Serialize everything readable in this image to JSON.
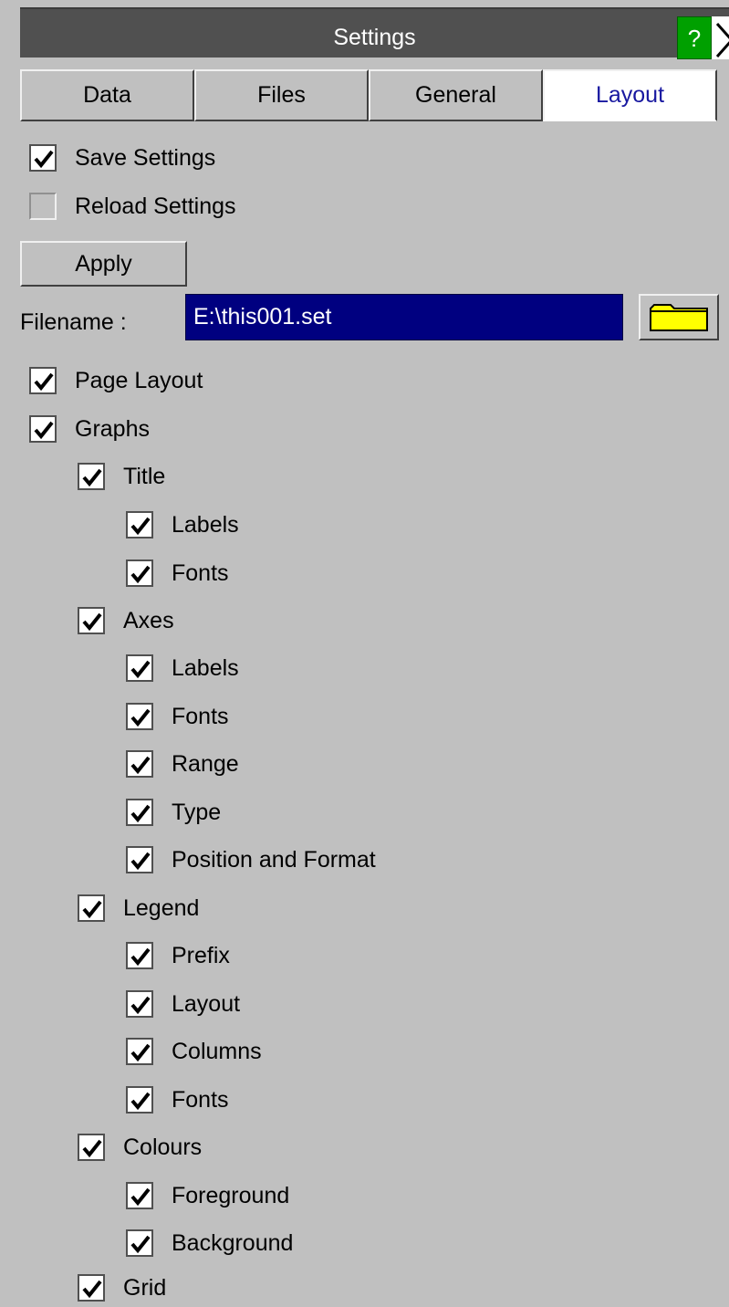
{
  "window": {
    "title": "Settings",
    "help_label": "?"
  },
  "tabs": [
    {
      "label": "Data",
      "active": false
    },
    {
      "label": "Files",
      "active": false
    },
    {
      "label": "General",
      "active": false
    },
    {
      "label": "Layout",
      "active": true
    }
  ],
  "settings": {
    "save": {
      "label": "Save Settings",
      "checked": true
    },
    "reload": {
      "label": "Reload Settings",
      "checked": false
    },
    "apply_label": "Apply",
    "filename_label": "Filename :",
    "filename_value": "E:\\this001.set"
  },
  "tree": {
    "page_layout": "Page Layout",
    "graphs": "Graphs",
    "title": "Title",
    "title_labels": "Labels",
    "title_fonts": "Fonts",
    "axes": "Axes",
    "axes_labels": "Labels",
    "axes_fonts": "Fonts",
    "axes_range": "Range",
    "axes_type": "Type",
    "axes_position": "Position and Format",
    "legend": "Legend",
    "legend_prefix": "Prefix",
    "legend_layout": "Layout",
    "legend_columns": "Columns",
    "legend_fonts": "Fonts",
    "colours": "Colours",
    "colours_foreground": "Foreground",
    "colours_background": "Background",
    "grid": "Grid"
  },
  "colors": {
    "panel": "#c0c0c0",
    "titlebar": "#505050",
    "help": "#00a000",
    "filename_field": "#000080",
    "folder": "#ffff00",
    "active_tab_text": "#1818a0"
  }
}
